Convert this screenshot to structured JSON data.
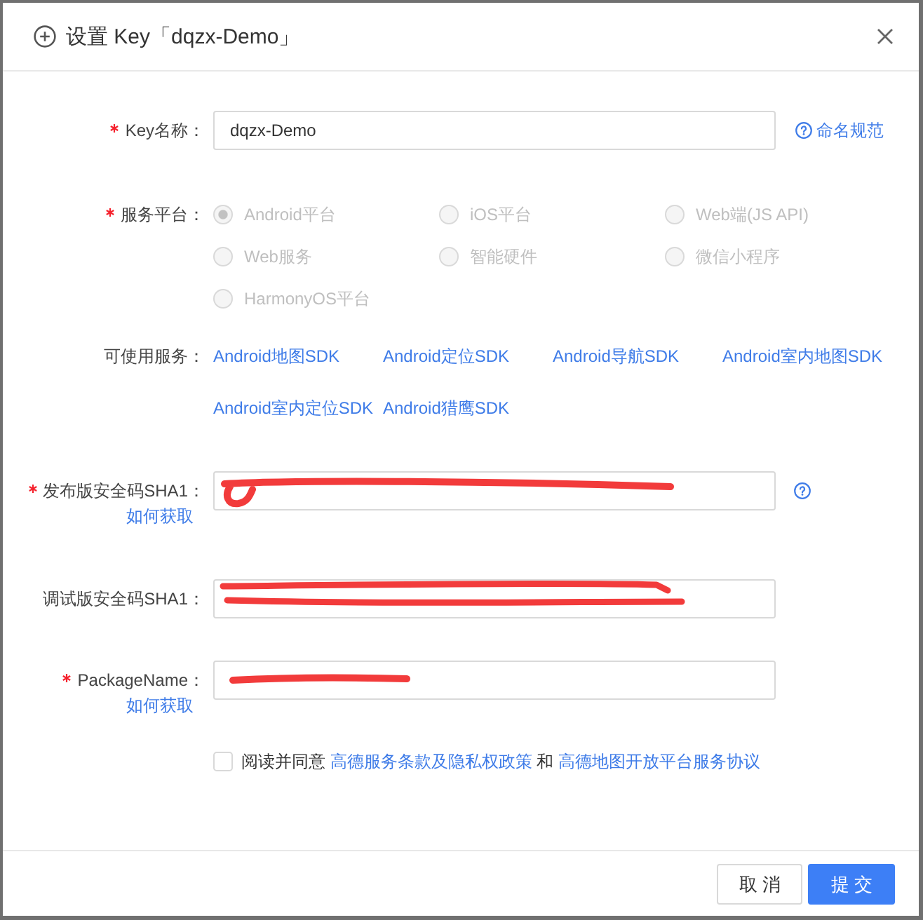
{
  "dialog": {
    "title": "设置 Key「dqzx-Demo」"
  },
  "fields": [
    {
      "kind": "input",
      "label": "Key名称：",
      "required": true,
      "value": "dqzx-Demo",
      "help_link": "命名规范"
    },
    {
      "kind": "radio",
      "label": "服务平台：",
      "required": true,
      "options": [
        {
          "label": "Android平台",
          "selected": true,
          "disabled": true
        },
        {
          "label": "iOS平台",
          "selected": false,
          "disabled": true
        },
        {
          "label": "Web端(JS API)",
          "selected": false,
          "disabled": true
        },
        {
          "label": "Web服务",
          "selected": false,
          "disabled": true
        },
        {
          "label": "智能硬件",
          "selected": false,
          "disabled": true
        },
        {
          "label": "微信小程序",
          "selected": false,
          "disabled": true
        },
        {
          "label": "HarmonyOS平台",
          "selected": false,
          "disabled": true
        }
      ]
    },
    {
      "kind": "links",
      "label": "可使用服务：",
      "links": [
        "Android地图SDK",
        "Android定位SDK",
        "Android导航SDK",
        "Android室内地图SDK",
        "Android室内定位SDK",
        "Android猎鹰SDK"
      ]
    },
    {
      "kind": "input",
      "label": "发布版安全码SHA1：",
      "required": true,
      "redacted": true,
      "help_icon": true,
      "sub_link": "如何获取"
    },
    {
      "kind": "input",
      "label": "调试版安全码SHA1：",
      "required": false,
      "redacted": true
    },
    {
      "kind": "input",
      "label": "PackageName：",
      "required": true,
      "redacted": true,
      "sub_link": "如何获取"
    }
  ],
  "agreement": {
    "checked": false,
    "parts": [
      {
        "kind": "text",
        "text": "阅读并同意"
      },
      {
        "kind": "link",
        "text": "高德服务条款及隐私权政策"
      },
      {
        "kind": "text",
        "text": "和"
      },
      {
        "kind": "link",
        "text": "高德地图开放平台服务协议"
      }
    ]
  },
  "buttons": [
    {
      "kind": "secondary",
      "label": "取 消"
    },
    {
      "kind": "primary",
      "label": "提 交"
    }
  ]
}
